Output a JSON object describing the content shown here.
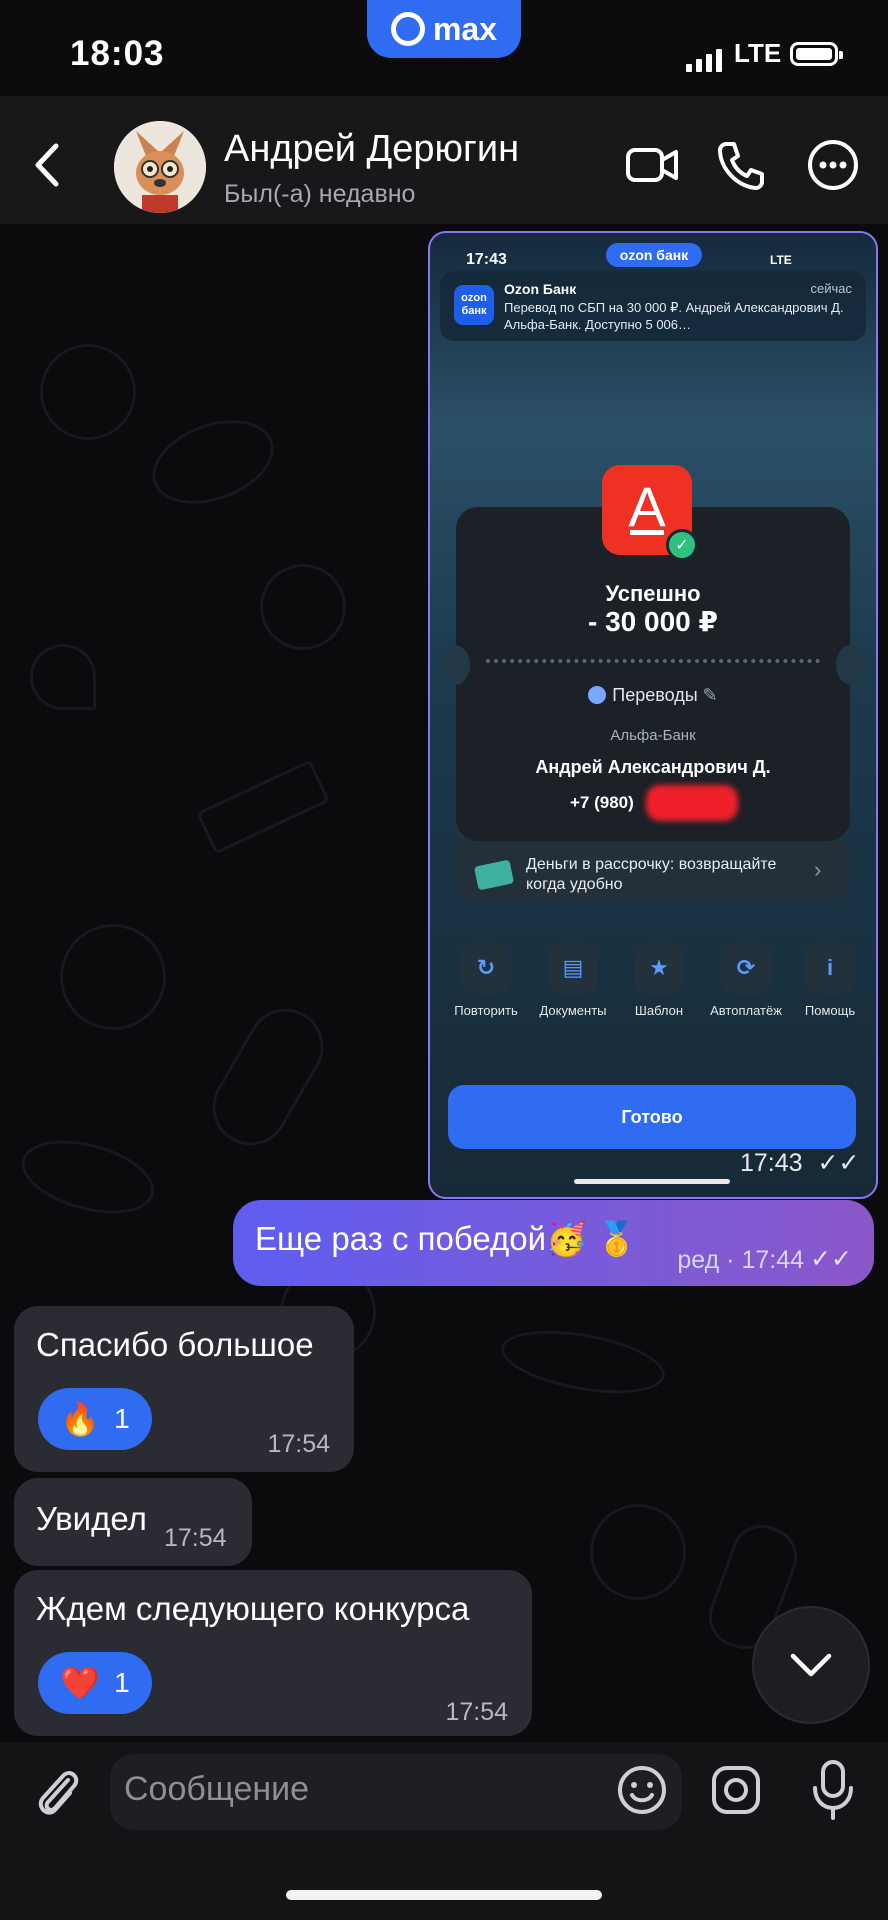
{
  "status_bar": {
    "time": "18:03",
    "app_badge": "max",
    "network": "LTE"
  },
  "header": {
    "contact_name": "Андрей Дерюгин",
    "contact_status": "Был(-а) недавно"
  },
  "screenshot_message": {
    "time": "17:43",
    "phone_status": {
      "time": "17:43",
      "island": "ozon банк",
      "network": "LTE"
    },
    "notification": {
      "app_icon_text": "ozon банк",
      "title": "Ozon Банк",
      "time": "сейчас",
      "body": "Перевод по СБП на 30 000 ₽. Андрей Александрович Д. Альфа-Банк. Доступно 5 006…"
    },
    "status": "Успешно",
    "amount": "- 30 000 ₽",
    "category": "Переводы",
    "bank": "Альфа-Банк",
    "recipient": "Андрей Александрович Д.",
    "phone": "+7 (980)",
    "promo": "Деньги в рассрочку: возвращайте когда удобно",
    "actions": [
      "Повторить",
      "Документы",
      "Шаблон",
      "Автоплатёж",
      "Помощь"
    ],
    "done_button": "Готово"
  },
  "messages": [
    {
      "direction": "out",
      "text": "Еще раз с победой🥳 🥇",
      "meta": "ред · 17:44"
    },
    {
      "direction": "in",
      "text": "Спасибо большое",
      "reaction_emoji": "🔥",
      "reaction_count": "1",
      "time": "17:54"
    },
    {
      "direction": "in",
      "text": "Увидел",
      "time": "17:54"
    },
    {
      "direction": "in",
      "text": "Ждем следующего конкурса",
      "reaction_emoji": "❤️",
      "reaction_count": "1",
      "time": "17:54"
    }
  ],
  "composer": {
    "placeholder": "Сообщение"
  },
  "colors": {
    "accent": "#2f6cf2",
    "outgoing_bubble": "#6b5ce6",
    "incoming_bubble": "#2b2b33",
    "background": "#0c0c0f"
  }
}
